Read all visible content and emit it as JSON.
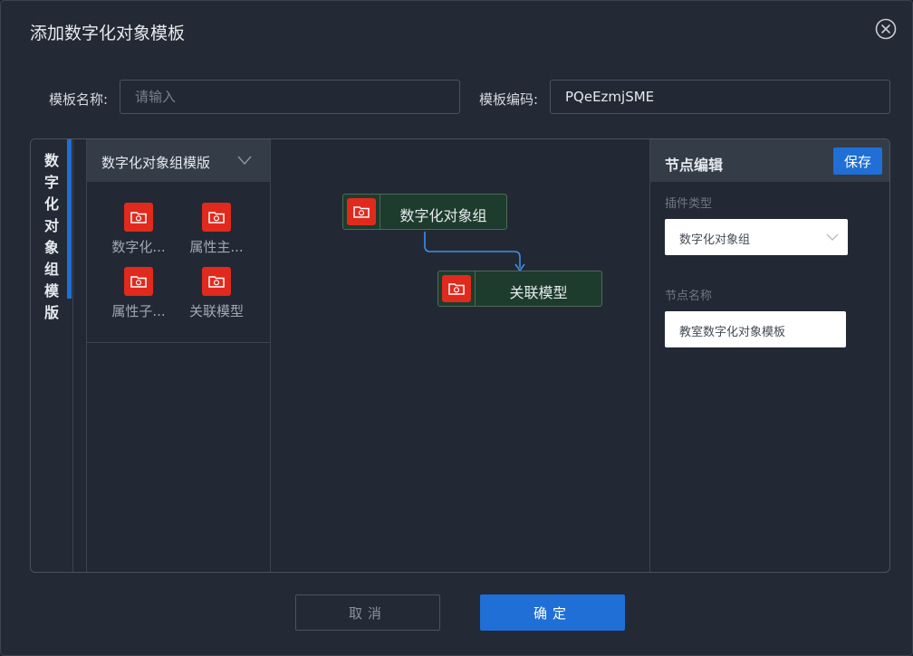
{
  "dialog": {
    "title": "添加数字化对象模板",
    "close_icon": "close-circle-icon"
  },
  "form": {
    "name_label": "模板名称:",
    "name_value": "",
    "name_placeholder": "请输入",
    "code_label": "模板编码:",
    "code_value": "PQeEzmjSME"
  },
  "vertical_tab": {
    "label": "数字化对象组模版"
  },
  "library": {
    "header": "数字化对象组模版",
    "items": [
      {
        "label": "数字化...",
        "icon": "folder-refresh-icon"
      },
      {
        "label": "属性主...",
        "icon": "folder-refresh-icon"
      },
      {
        "label": "属性子...",
        "icon": "folder-refresh-icon"
      },
      {
        "label": "关联模型",
        "icon": "folder-refresh-icon"
      }
    ]
  },
  "canvas": {
    "nodes": [
      {
        "label": "数字化对象组",
        "icon": "folder-refresh-icon"
      },
      {
        "label": "关联模型",
        "icon": "folder-refresh-icon"
      }
    ]
  },
  "node_editor": {
    "title": "节点编辑",
    "save_label": "保存",
    "plugin_type_label": "插件类型",
    "plugin_type_value": "数字化对象组",
    "node_name_label": "节点名称",
    "node_name_value": "教室数字化对象模板"
  },
  "footer": {
    "cancel_label": "取消",
    "confirm_label": "确定"
  },
  "colors": {
    "background": "#232a35",
    "accent": "#1f6fd6",
    "icon_red": "#e02a1d",
    "node_fill": "#1e3c2d",
    "connector": "#3d8fe6"
  }
}
